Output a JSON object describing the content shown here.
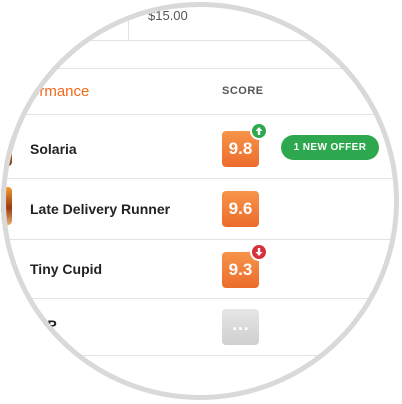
{
  "top_row": {
    "price": "$15.00"
  },
  "table": {
    "header": {
      "title": "ormance",
      "score_label": "SCORE"
    },
    "rows": [
      {
        "name": "Solaria",
        "score": "9.8",
        "trend": "up",
        "offer_label": "1 NEW OFFER"
      },
      {
        "name": "Late Delivery Runner",
        "score": "9.6",
        "trend": "none"
      },
      {
        "name": "Tiny Cupid",
        "score": "9.3",
        "trend": "down"
      },
      {
        "name": "VP",
        "score": "…",
        "trend": "none"
      }
    ]
  },
  "colors": {
    "accent_orange": "#f06a1a",
    "score_orange": "#ec6c2c",
    "offer_green": "#2ea84f",
    "trend_down_red": "#d6303a",
    "ring_gray": "#d9d9d9"
  },
  "icons": {
    "trend_up": "arrow-up-icon",
    "trend_down": "arrow-down-icon"
  }
}
